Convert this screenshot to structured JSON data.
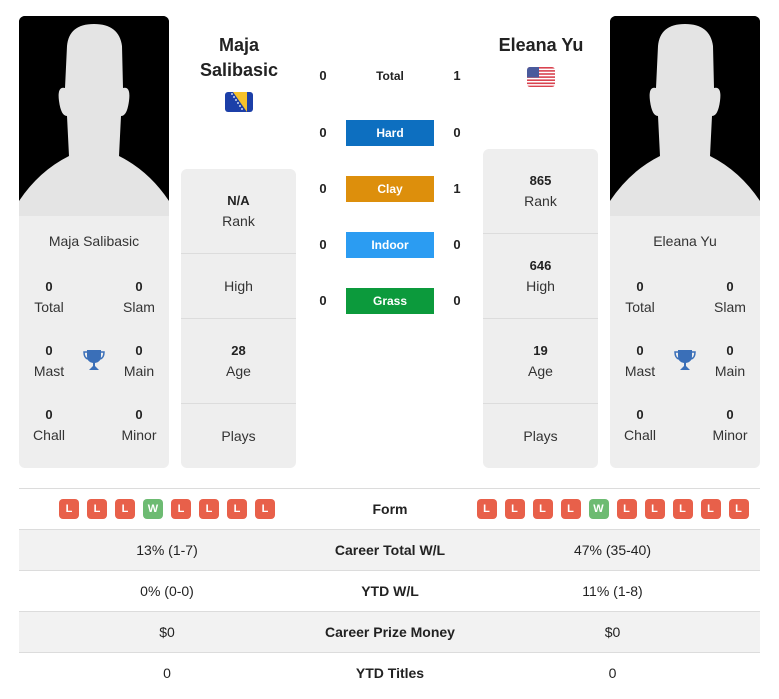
{
  "players": {
    "left": {
      "name": "Maja Salibasic",
      "name_lines": [
        "Maja",
        "Salibasic"
      ],
      "country_flag": "bosnia-herzegovina-flag",
      "titles": {
        "total": {
          "value": "0",
          "label": "Total"
        },
        "slam": {
          "value": "0",
          "label": "Slam"
        },
        "mast": {
          "value": "0",
          "label": "Mast"
        },
        "main": {
          "value": "0",
          "label": "Main"
        },
        "chall": {
          "value": "0",
          "label": "Chall"
        },
        "minor": {
          "value": "0",
          "label": "Minor"
        }
      },
      "stats": {
        "rank": {
          "value": "N/A",
          "label": "Rank"
        },
        "high": {
          "value": "",
          "label": "High"
        },
        "age": {
          "value": "28",
          "label": "Age"
        },
        "plays": {
          "value": "",
          "label": "Plays"
        }
      }
    },
    "right": {
      "name": "Eleana Yu",
      "country_flag": "usa-flag",
      "titles": {
        "total": {
          "value": "0",
          "label": "Total"
        },
        "slam": {
          "value": "0",
          "label": "Slam"
        },
        "mast": {
          "value": "0",
          "label": "Mast"
        },
        "main": {
          "value": "0",
          "label": "Main"
        },
        "chall": {
          "value": "0",
          "label": "Chall"
        },
        "minor": {
          "value": "0",
          "label": "Minor"
        }
      },
      "stats": {
        "rank": {
          "value": "865",
          "label": "Rank"
        },
        "high": {
          "value": "646",
          "label": "High"
        },
        "age": {
          "value": "19",
          "label": "Age"
        },
        "plays": {
          "value": "",
          "label": "Plays"
        }
      }
    }
  },
  "h2h": {
    "total": {
      "label": "Total",
      "left": "0",
      "right": "1"
    },
    "surfaces": [
      {
        "label": "Hard",
        "left": "0",
        "right": "0",
        "color": "#0d6fc0"
      },
      {
        "label": "Clay",
        "left": "0",
        "right": "1",
        "color": "#dd8f0c"
      },
      {
        "label": "Indoor",
        "left": "0",
        "right": "0",
        "color": "#2b9cf2"
      },
      {
        "label": "Grass",
        "left": "0",
        "right": "0",
        "color": "#0c9a3c"
      }
    ]
  },
  "comparison": {
    "form": {
      "label": "Form",
      "left": [
        "L",
        "L",
        "L",
        "W",
        "L",
        "L",
        "L",
        "L"
      ],
      "right": [
        "L",
        "L",
        "L",
        "L",
        "W",
        "L",
        "L",
        "L",
        "L",
        "L"
      ]
    },
    "rows": [
      {
        "label": "Career Total W/L",
        "left": "13% (1-7)",
        "right": "47% (35-40)"
      },
      {
        "label": "YTD W/L",
        "left": "0% (0-0)",
        "right": "11% (1-8)"
      },
      {
        "label": "Career Prize Money",
        "left": "$0",
        "right": "$0"
      },
      {
        "label": "YTD Titles",
        "left": "0",
        "right": "0"
      }
    ]
  },
  "colors": {
    "loss": "#e8604a",
    "win": "#6dbb72",
    "trophy": "#3a6fb8"
  }
}
